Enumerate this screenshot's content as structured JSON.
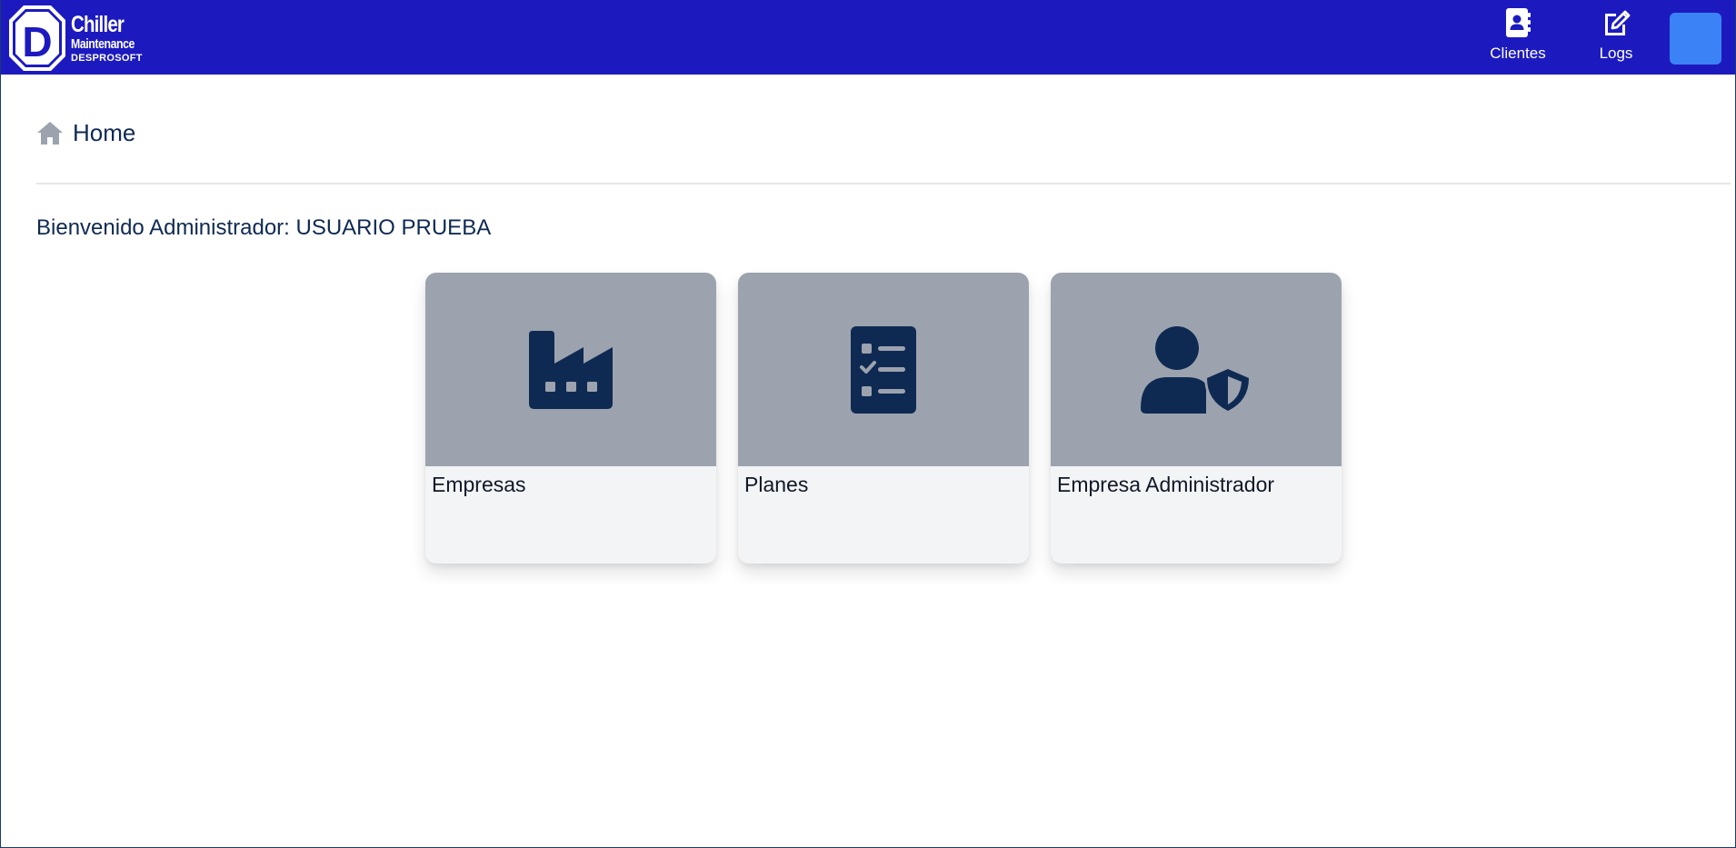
{
  "app": {
    "logo_line1": "Chiller",
    "logo_line2": "Maintenance",
    "logo_line3": "DESPROSOFT",
    "logo_letter": "D",
    "accent_color": "#1c1abf",
    "avatar_color": "#3b82f6"
  },
  "nav": {
    "items": [
      {
        "label": "Clientes",
        "icon": "address-book-icon"
      },
      {
        "label": "Logs",
        "icon": "edit-icon"
      }
    ]
  },
  "breadcrumb": {
    "icon": "home-icon",
    "label": "Home"
  },
  "welcome": {
    "text": "Bienvenido Administrador: USUARIO PRUEBA"
  },
  "cards": [
    {
      "title": "Empresas",
      "icon": "factory-icon"
    },
    {
      "title": "Planes",
      "icon": "checklist-icon"
    },
    {
      "title": "Empresa Administrador",
      "icon": "user-shield-icon"
    }
  ]
}
